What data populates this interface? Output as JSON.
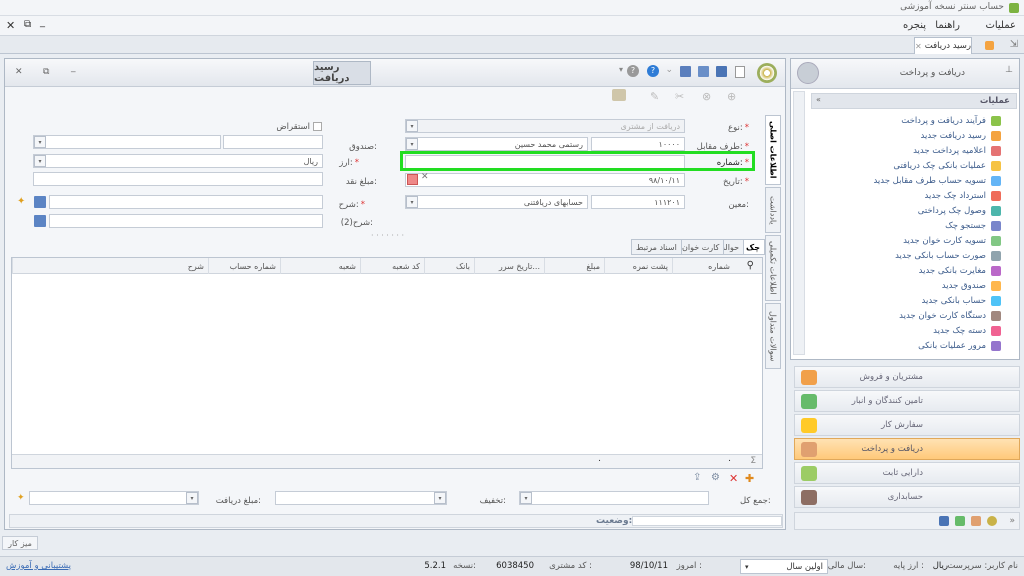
{
  "app": {
    "title": "حساب سنتر نسخه آموزشی"
  },
  "menu": {
    "operations": "عملیات",
    "help": "راهنما",
    "window": "پنجره"
  },
  "doc_tab": {
    "label": "رسید دریافت"
  },
  "form": {
    "caption": "رسید دریافت",
    "vertical_tabs": [
      "اطلاعات اصلی",
      "یادداشت",
      "اطلاعات تکمیلی",
      "سوالات متداول"
    ],
    "labels": {
      "type": "نوع:",
      "counterparty": "طرف مقابل:",
      "number": "شماره:",
      "date": "تاریخ:",
      "moein": "معین:",
      "fund": "صندوق:",
      "currency": "ارز:",
      "cash_amount": "مبلغ نقد:",
      "desc": "شرح:",
      "desc2": "شرح(2):",
      "reverse": "استقراض"
    },
    "values": {
      "type": "دریافت از مشتری",
      "counterparty_code": "۱۰۰۰۰",
      "counterparty_name": "رستمی محمد حسین",
      "number": "",
      "date": "۹۸/۱۰/۱۱",
      "moein_code": "۱۱۱۲۰۱",
      "moein_name": "حسابهای دریافتنی",
      "currency": "ریال"
    }
  },
  "tabs": [
    "چک",
    "حواله",
    "کارت خوان",
    "اسناد مرتبط"
  ],
  "grid": {
    "columns": [
      "شماره",
      "پشت نمره",
      "مبلغ",
      "تاریخ سرر...",
      "بانک",
      "کد شعبه",
      "شعبه",
      "شماره حساب",
      "شرح"
    ],
    "footer_sum": "۰"
  },
  "bottom": {
    "total": "جمع کل:",
    "discount": "تخفیف:",
    "received": "مبلغ دریافت:",
    "status": "وضعیت:"
  },
  "side": {
    "header": "دریافت و پرداخت",
    "section": "عملیات",
    "items": [
      {
        "label": "فرآیند دریافت و پرداخت",
        "color": "#8bc34a"
      },
      {
        "label": "رسید دریافت جدید",
        "color": "#f4a340"
      },
      {
        "label": "اعلامیه پرداخت جدید",
        "color": "#e57373"
      },
      {
        "label": "عملیات بانکی چک دریافتی",
        "color": "#f6c344"
      },
      {
        "label": "تسویه حساب طرف مقابل جدید",
        "color": "#64b5f6"
      },
      {
        "label": "استرداد چک جدید",
        "color": "#ef6c5a"
      },
      {
        "label": "وصول چک پرداختی",
        "color": "#4db6ac"
      },
      {
        "label": "جستجو چک",
        "color": "#7986cb"
      },
      {
        "label": "تسویه کارت خوان جدید",
        "color": "#81c784"
      },
      {
        "label": "صورت حساب بانکی جدید",
        "color": "#90a4ae"
      },
      {
        "label": "مغایرت بانکی جدید",
        "color": "#ba68c8"
      },
      {
        "label": "صندوق جدید",
        "color": "#ffb74d"
      },
      {
        "label": "حساب بانکی جدید",
        "color": "#4fc3f7"
      },
      {
        "label": "دستگاه کارت خوان جدید",
        "color": "#a1887f"
      },
      {
        "label": "دسته چک جدید",
        "color": "#f06292"
      },
      {
        "label": "مرور عملیات بانکی",
        "color": "#9575cd"
      }
    ]
  },
  "categories": [
    {
      "label": "مشتریان و فروش",
      "color": "#f1a04a"
    },
    {
      "label": "تامین کنندگان و انبار",
      "color": "#66bb6a"
    },
    {
      "label": "سفارش کار",
      "color": "#ffca28"
    },
    {
      "label": "دریافت و پرداخت",
      "color": "#e0a070"
    },
    {
      "label": "دارایی ثابت",
      "color": "#9ccc65"
    },
    {
      "label": "حسابداری",
      "color": "#8d6e63"
    }
  ],
  "desktop_label": "میز کار",
  "status": {
    "user": "نام کاربر: سرپرست",
    "base_currency": "ارز پایه :",
    "currency": "ریال",
    "fiscal_year_label": "سال مالی:",
    "fiscal_year": "اولین سال",
    "today_label": "امروز :",
    "today": "98/10/11",
    "customer_code_label": "کد مشتری :",
    "customer_code": "6038450",
    "version_label": "نسخه:",
    "version": "5.2.1",
    "support": "پشتیبانی و آموزش"
  }
}
